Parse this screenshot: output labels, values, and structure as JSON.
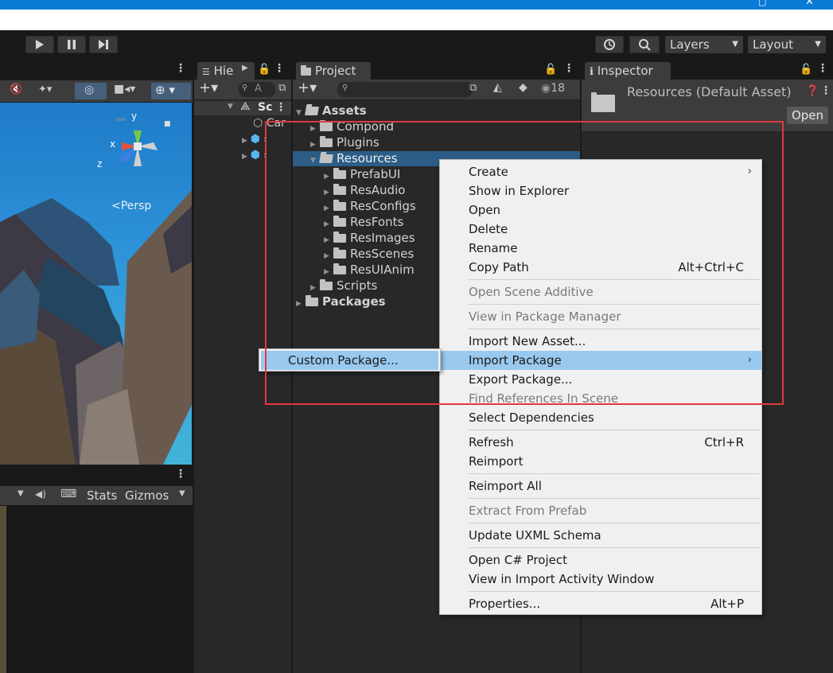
{
  "toolbar": {
    "layers_label": "Layers",
    "layout_label": "Layout"
  },
  "scene": {
    "persp_label": "<Persp",
    "axis_x": "x",
    "axis_y": "y",
    "axis_z": "z"
  },
  "game": {
    "stats_label": "Stats",
    "gizmos_label": "Gizmos"
  },
  "hierarchy": {
    "tab_label": "Hie",
    "search_placeholder": "A",
    "scene_label": "Sc",
    "item_camera": "Car"
  },
  "project": {
    "tab_label": "Project",
    "hidden_count": "18",
    "tree": [
      {
        "label": "Assets",
        "bold": true
      },
      {
        "label": "Compond"
      },
      {
        "label": "Plugins"
      },
      {
        "label": "Resources",
        "selected": true
      },
      {
        "label": "PrefabUI"
      },
      {
        "label": "ResAudio"
      },
      {
        "label": "ResConfigs"
      },
      {
        "label": "ResFonts"
      },
      {
        "label": "ResImages"
      },
      {
        "label": "ResScenes"
      },
      {
        "label": "ResUIAnim"
      },
      {
        "label": "Scripts"
      },
      {
        "label": "Packages",
        "bold": true
      }
    ]
  },
  "inspector": {
    "tab_label": "Inspector",
    "asset_title": "Resources (Default Asset)",
    "open_button": "Open"
  },
  "context_menu": {
    "items": [
      {
        "label": "Create",
        "submenu": true
      },
      {
        "label": "Show in Explorer"
      },
      {
        "label": "Open"
      },
      {
        "label": "Delete"
      },
      {
        "label": "Rename"
      },
      {
        "label": "Copy Path",
        "shortcut": "Alt+Ctrl+C"
      },
      {
        "label": "Open Scene Additive",
        "disabled": true
      },
      {
        "label": "View in Package Manager",
        "disabled": true
      },
      {
        "label": "Import New Asset..."
      },
      {
        "label": "Import Package",
        "submenu": true,
        "highlighted": true
      },
      {
        "label": "Export Package..."
      },
      {
        "label": "Find References In Scene",
        "disabled": true
      },
      {
        "label": "Select Dependencies"
      },
      {
        "label": "Refresh",
        "shortcut": "Ctrl+R"
      },
      {
        "label": "Reimport"
      },
      {
        "label": "Reimport All"
      },
      {
        "label": "Extract From Prefab",
        "disabled": true
      },
      {
        "label": "Update UXML Schema"
      },
      {
        "label": "Open C# Project"
      },
      {
        "label": "View in Import Activity Window"
      },
      {
        "label": "Properties...",
        "shortcut": "Alt+P"
      }
    ]
  },
  "submenu": {
    "custom_package": "Custom Package..."
  },
  "colors": {
    "highlight": "#99c9ef",
    "annotation": "#e0393e",
    "title_blue": "#0a7ad6"
  }
}
